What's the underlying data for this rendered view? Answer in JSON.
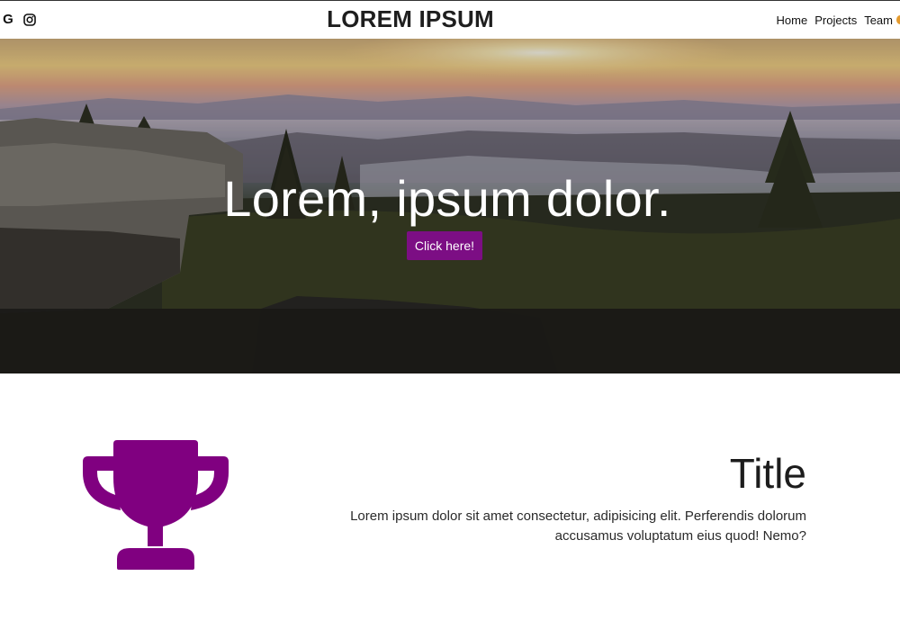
{
  "navbar": {
    "brand": "LOREM IPSUM",
    "social": {
      "google_glyph": "G",
      "google_icon": "google-icon",
      "instagram_icon": "instagram-icon"
    },
    "links": [
      "Home",
      "Projects",
      "Team"
    ]
  },
  "hero": {
    "title": "Lorem, ipsum dolor.",
    "button_label": "Click here!",
    "accent_color": "#7c0e84",
    "background": "mountain sunrise landscape"
  },
  "feature": {
    "icon": "trophy-icon",
    "icon_color": "#800080",
    "title": "Title",
    "text": "Lorem ipsum dolor sit amet consectetur, adipisicing elit. Perferendis dolorum accusamus voluptatum eius quod! Nemo?"
  }
}
